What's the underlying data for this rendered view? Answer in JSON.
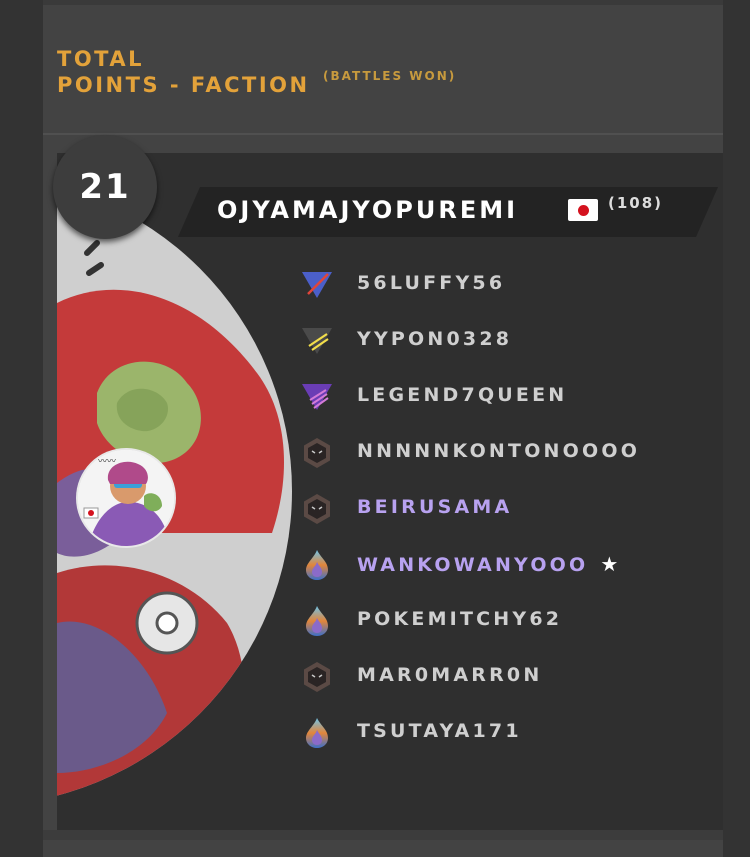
{
  "header": {
    "title": "TOTAL\nPOINTS - FACTION",
    "subtitle": "(BATTLES WON)"
  },
  "entry": {
    "rank": "21",
    "player_name": "OJYAMAJYOPUREMI",
    "count": "(108)",
    "flag_icon": "japan-flag-icon"
  },
  "team": [
    {
      "name": "56LUFFY56",
      "icon": "triangle-rank-icon-blue",
      "highlight": false,
      "starred": false
    },
    {
      "name": "YYPON0328",
      "icon": "triangle-rank-icon-dark",
      "highlight": false,
      "starred": false
    },
    {
      "name": "LEGEND7QUEEN",
      "icon": "triangle-rank-icon-purple",
      "highlight": false,
      "starred": false
    },
    {
      "name": "NNNNNKONTONOOOO",
      "icon": "hexagon-rank-icon",
      "highlight": false,
      "starred": false
    },
    {
      "name": "BEIRUSAMA",
      "icon": "hexagon-rank-icon",
      "highlight": true,
      "starred": false
    },
    {
      "name": "WANKOWANYOOO",
      "icon": "flame-rank-icon",
      "highlight": true,
      "starred": true,
      "star": "★"
    },
    {
      "name": "POKEMITCHY62",
      "icon": "flame-rank-icon",
      "highlight": false,
      "starred": false
    },
    {
      "name": "MAR0MARR0N",
      "icon": "hexagon-rank-icon",
      "highlight": false,
      "starred": false
    },
    {
      "name": "TSUTAYA171",
      "icon": "flame-rank-icon",
      "highlight": false,
      "starred": false
    }
  ],
  "colors": {
    "accent": "#e3a23a",
    "highlight_name": "#b8a2f0",
    "name": "#cfcfcf"
  }
}
